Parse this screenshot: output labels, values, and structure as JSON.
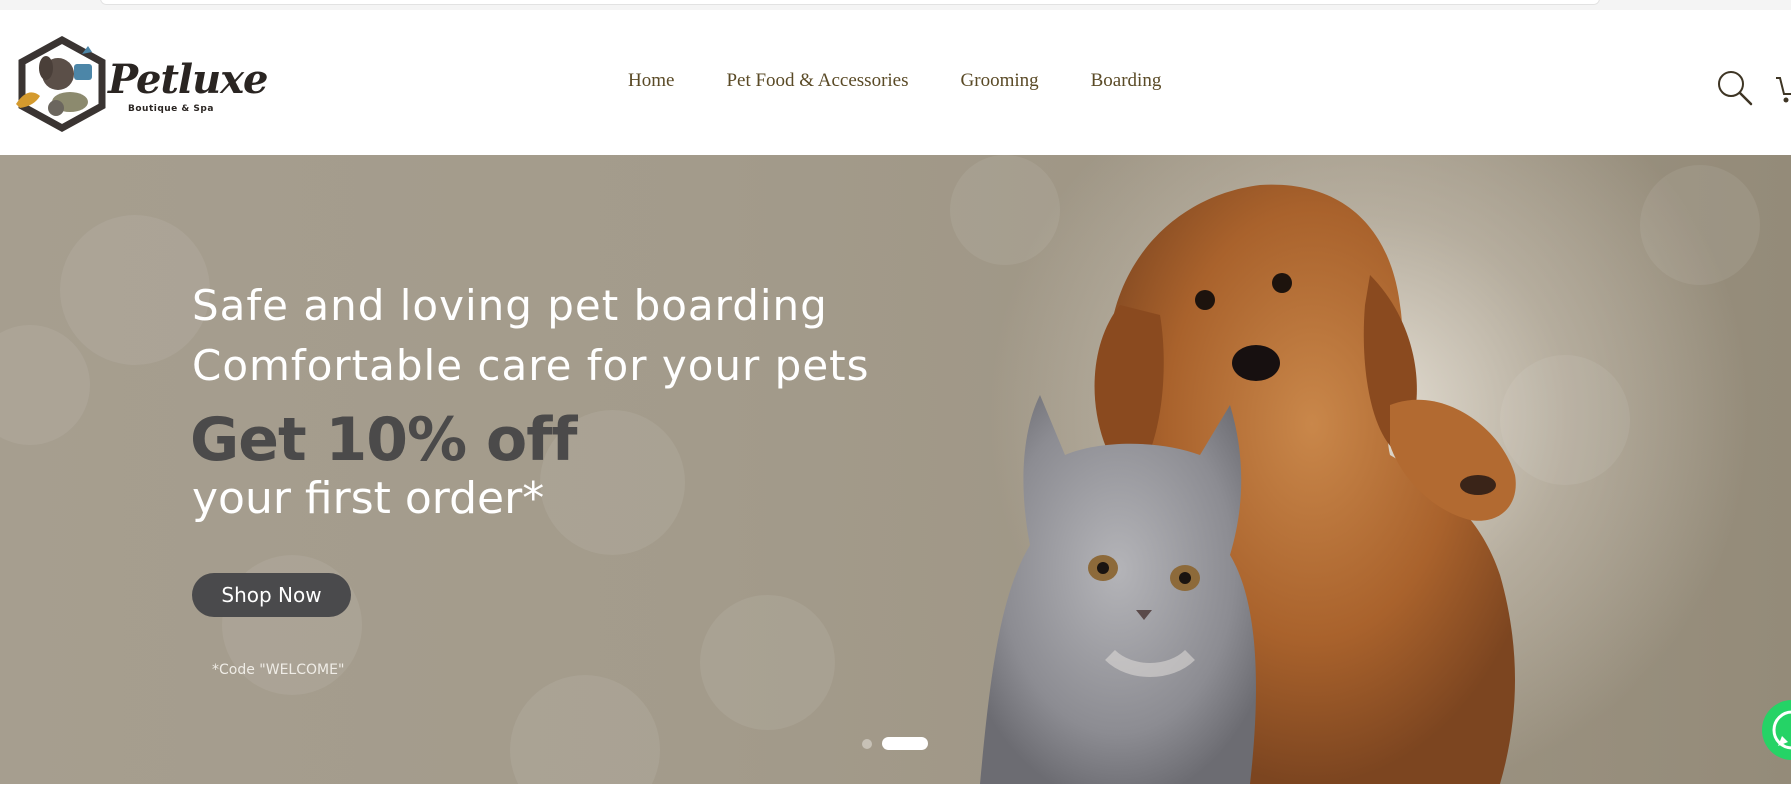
{
  "brand": {
    "name": "Petluxe",
    "tagline": "Boutique & Spa"
  },
  "nav": {
    "items": [
      {
        "label": "Home"
      },
      {
        "label": "Pet Food & Accessories"
      },
      {
        "label": "Grooming"
      },
      {
        "label": "Boarding"
      }
    ]
  },
  "header": {
    "search_icon": "search-icon",
    "cart_icon": "cart-icon"
  },
  "hero": {
    "line1": "Safe and loving pet boarding",
    "line2": "Comfortable care for your pets",
    "promo_headline": "Get 10% off",
    "promo_subline": "your first order*",
    "cta_label": "Shop Now",
    "code_note": "*Code \"WELCOME\"",
    "slides_total": 2,
    "slide_active": 2
  },
  "floating": {
    "chat_icon": "whatsapp-icon"
  },
  "colors": {
    "nav_text": "#5a4a26",
    "hero_bg": "#a39b8b",
    "cta_bg": "#4a4a4c",
    "promo_text": "#4b4a4a"
  }
}
